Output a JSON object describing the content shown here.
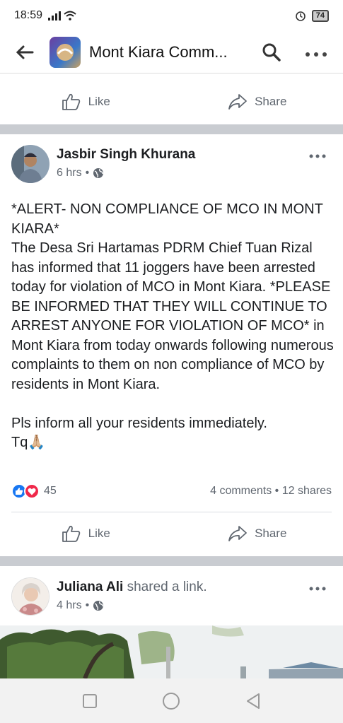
{
  "status_bar": {
    "time": "18:59",
    "battery": "74"
  },
  "app_bar": {
    "title": "Mont Kiara Comm...",
    "back_icon": "arrow-left-icon",
    "search_icon": "search-icon",
    "more_icon": "more-icon"
  },
  "actions": {
    "like_label": "Like",
    "share_label": "Share"
  },
  "post1": {
    "author": "Jasbir Singh Khurana",
    "time": "6 hrs",
    "separator": "•",
    "text": "*ALERT- NON COMPLIANCE OF MCO IN MONT KIARA*\nThe Desa Sri Hartamas PDRM Chief Tuan Rizal has informed that 11 joggers have been arrested today for violation of MCO in Mont Kiara. *PLEASE BE INFORMED THAT THEY WILL CONTINUE TO ARREST ANYONE FOR VIOLATION OF MCO* in Mont Kiara from today onwards following numerous complaints to them on non compliance of MCO by residents in Mont Kiara.\n\nPls inform all your residents immediately.\nTq🙏🏼",
    "reaction_count": "45",
    "comments": "4 comments",
    "shares": "12 shares",
    "stats_separator": " • "
  },
  "post2": {
    "author": "Juliana Ali",
    "action": "shared a link.",
    "time": "4 hrs",
    "separator": "•"
  },
  "colors": {
    "facebook_blue": "#1877f2",
    "love_red": "#f0284a",
    "divider": "#c9ccd1",
    "secondary_text": "#606770"
  }
}
